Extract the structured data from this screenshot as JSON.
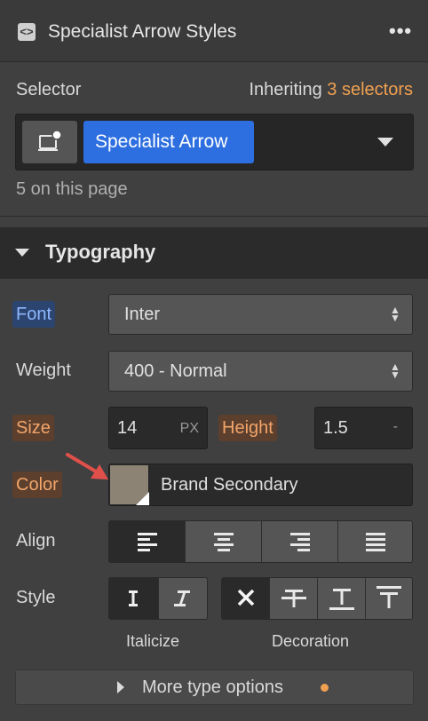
{
  "header": {
    "title": "Specialist Arrow Styles",
    "icon": "code-brackets-icon",
    "more_icon": "more-dots-icon"
  },
  "selector": {
    "label": "Selector",
    "inheriting_prefix": "Inheriting",
    "inheriting_count": "3 selectors",
    "tag": "Specialist Arrow",
    "page_count": "5 on this page"
  },
  "typography": {
    "title": "Typography",
    "font": {
      "label": "Font",
      "value": "Inter"
    },
    "weight": {
      "label": "Weight",
      "value": "400 - Normal"
    },
    "size": {
      "label": "Size",
      "value": "14",
      "unit": "PX"
    },
    "height": {
      "label": "Height",
      "value": "1.5",
      "unit": "-"
    },
    "color": {
      "label": "Color",
      "value": "Brand Secondary",
      "swatch": "#8c8375"
    },
    "align": {
      "label": "Align",
      "options": [
        "left",
        "center",
        "right",
        "justify"
      ],
      "selected": "left"
    },
    "style": {
      "label": "Style",
      "italicize_label": "Italicize",
      "decoration_label": "Decoration"
    },
    "more_options": "More type options"
  },
  "colors": {
    "accent_orange": "#f0a050",
    "accent_blue": "#2d6fe0",
    "annotation_arrow": "#e0504a"
  }
}
